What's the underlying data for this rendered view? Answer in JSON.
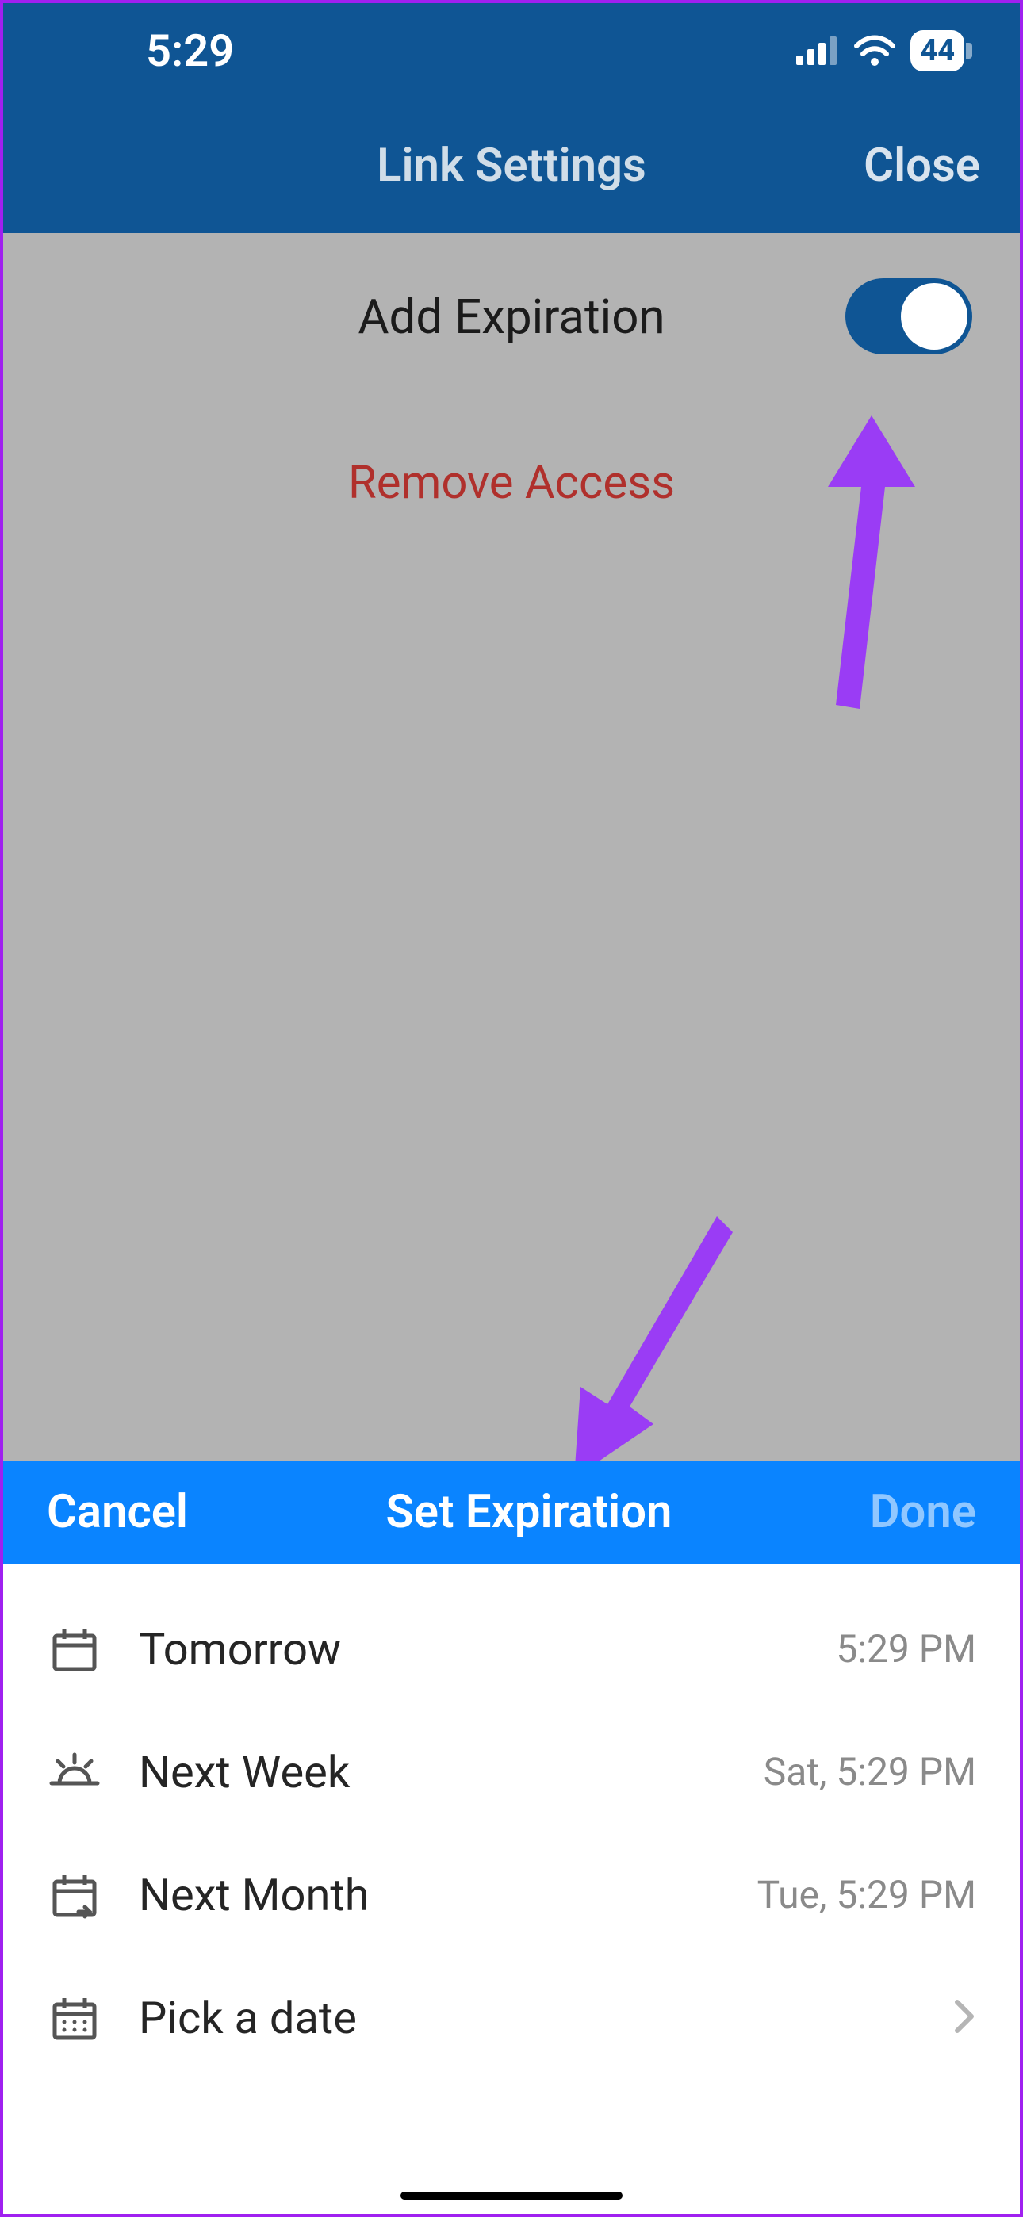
{
  "status": {
    "time": "5:29",
    "battery": "44"
  },
  "nav": {
    "title": "Link Settings",
    "close": "Close"
  },
  "main": {
    "add_expiration_label": "Add Expiration",
    "add_expiration_on": true,
    "remove_access_label": "Remove Access"
  },
  "sheet": {
    "cancel": "Cancel",
    "title": "Set Expiration",
    "done": "Done",
    "options": [
      {
        "label": "Tomorrow",
        "value": "5:29 PM"
      },
      {
        "label": "Next Week",
        "value": "Sat, 5:29 PM"
      },
      {
        "label": "Next Month",
        "value": "Tue, 5:29 PM"
      },
      {
        "label": "Pick a date",
        "value": ""
      }
    ]
  },
  "colors": {
    "header_blue": "#0f5594",
    "sheet_blue": "#0a84ff",
    "danger_red": "#b0302c",
    "annotation_purple": "#9a3cf5"
  }
}
